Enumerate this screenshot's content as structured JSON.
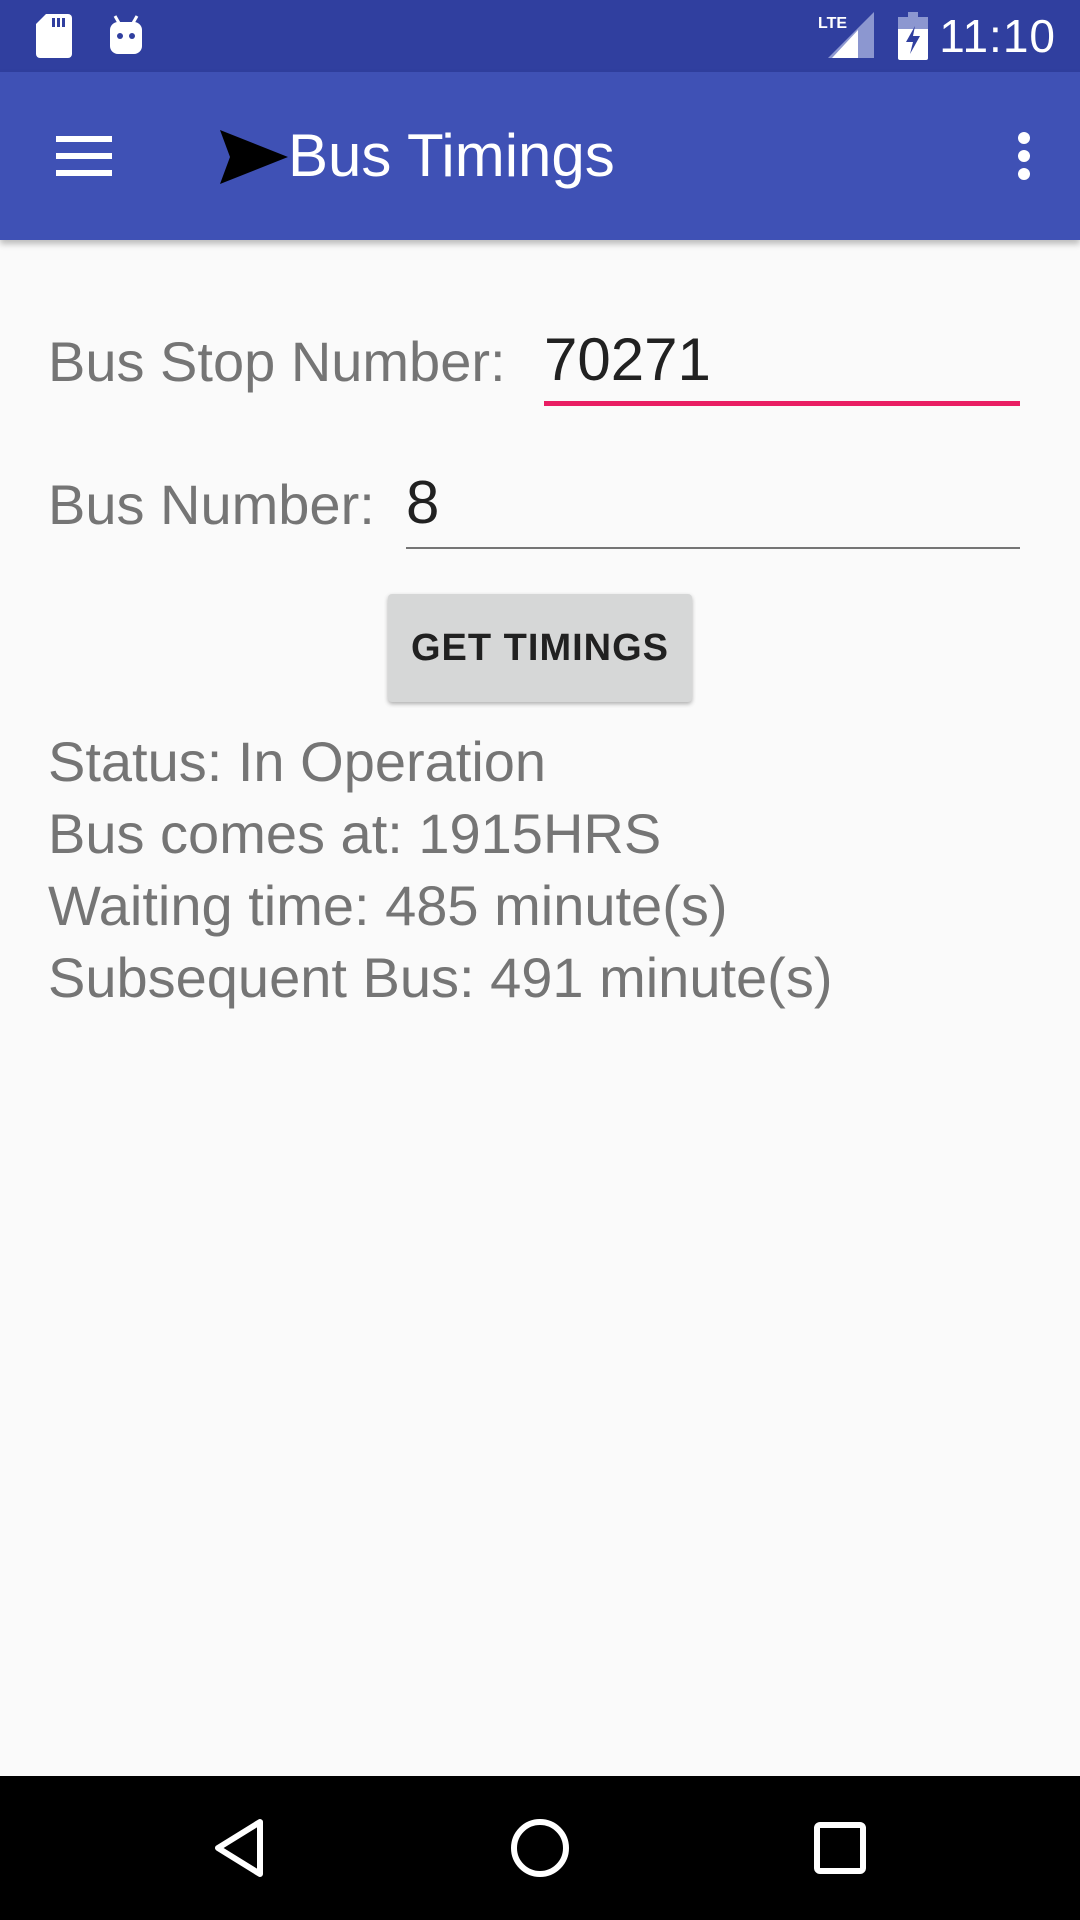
{
  "status_bar": {
    "time": "11:10",
    "icons": [
      "sd-card-icon",
      "android-debug-icon",
      "lte-signal-icon",
      "battery-charging-icon"
    ],
    "network_label": "LTE"
  },
  "app_bar": {
    "title": "Bus Timings",
    "logo_icon": "send-icon",
    "menu_icon": "hamburger-menu-icon",
    "overflow_icon": "more-vert-icon",
    "background_color": "#3f51b5"
  },
  "form": {
    "stop_label": "Bus Stop Number:",
    "stop_value": "70271",
    "bus_label": "Bus Number:",
    "bus_value": "8",
    "accent_color": "#e91e63"
  },
  "actions": {
    "get_timings_label": "GET TIMINGS"
  },
  "results": {
    "status": "Status: In Operation",
    "arrival": "Bus comes at: 1915HRS",
    "waiting": "Waiting time: 485 minute(s)",
    "subsequent": "Subsequent Bus: 491 minute(s)"
  },
  "nav_bar": {
    "buttons": [
      "back-icon",
      "home-icon",
      "recents-icon"
    ]
  }
}
